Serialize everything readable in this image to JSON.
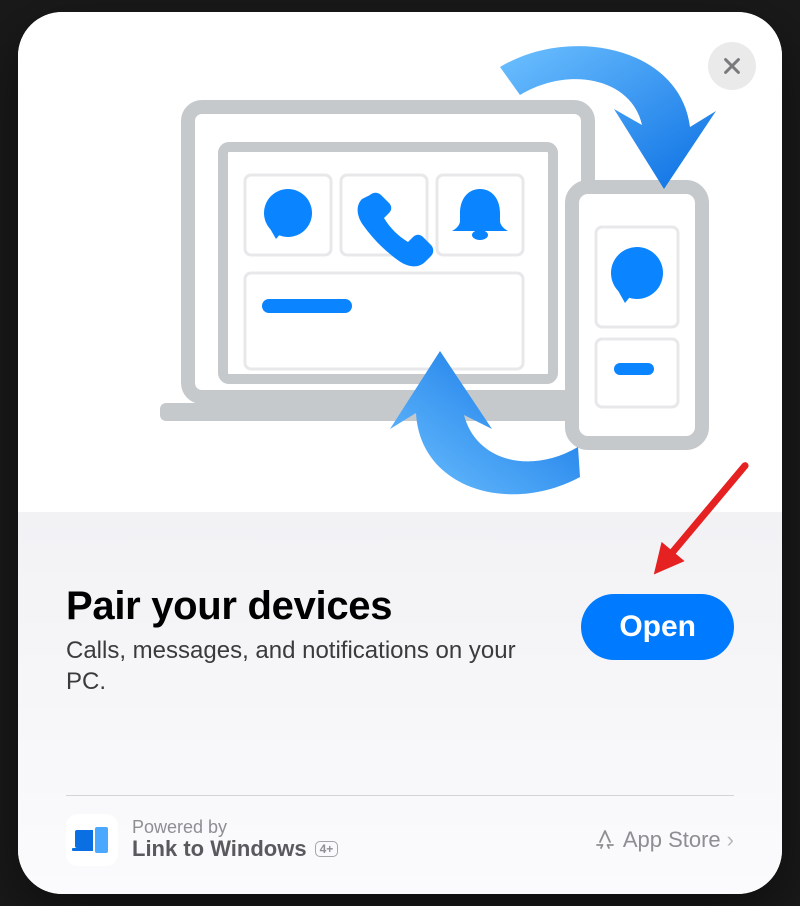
{
  "hero": {
    "icons": [
      "chat-bubble",
      "phone",
      "bell"
    ]
  },
  "main": {
    "title": "Pair your devices",
    "subtitle": "Calls, messages, and notifications on your PC.",
    "open_label": "Open"
  },
  "footer": {
    "powered_by_label": "Powered by",
    "app_name": "Link to Windows",
    "age_rating": "4+",
    "store_label": "App Store"
  },
  "colors": {
    "accent": "#007AFF",
    "illustration_blue": "#0a85ff",
    "illustration_gray": "#c6c9cc"
  },
  "annotation": {
    "type": "pointer-arrow",
    "target": "open-button"
  }
}
